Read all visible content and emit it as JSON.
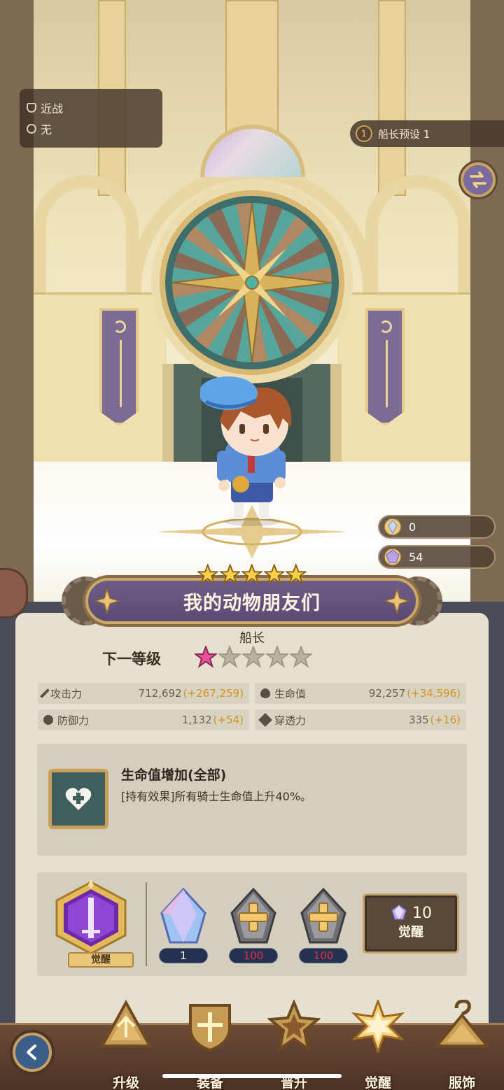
{
  "scene": {
    "attack_type": "近战",
    "element": "无",
    "preset": {
      "number": "1",
      "label": "船长预设 1"
    },
    "currencies": [
      {
        "icon": "crystal-icon",
        "value": "0"
      },
      {
        "icon": "purple-gem-icon",
        "value": "54"
      }
    ]
  },
  "hero": {
    "name": "我的动物朋友们",
    "star_count": 5,
    "role": "船长"
  },
  "panel": {
    "next_level_label": "下一等级",
    "next_level_stars": 5,
    "next_level_filled": 1,
    "stats": [
      {
        "icon": "sword-icon",
        "label": "攻击力",
        "value": "712,692",
        "bonus": "(+267,259)"
      },
      {
        "icon": "heart-icon",
        "label": "生命值",
        "value": "92,257",
        "bonus": "(+34,596)"
      },
      {
        "icon": "shield-icon",
        "label": "防御力",
        "value": "1,132",
        "bonus": "(+54)"
      },
      {
        "icon": "pierce-icon",
        "label": "穿透力",
        "value": "335",
        "bonus": "(+16)"
      }
    ],
    "effect": {
      "title": "生命值增加(全部)",
      "description": "[持有效果]所有骑士生命值上升40%。"
    },
    "awaken": {
      "badge_label": "觉醒",
      "materials": [
        {
          "icon": "crystal-shard-icon",
          "count": "1",
          "insufficient": false
        },
        {
          "icon": "plus-slot-icon",
          "count": "100",
          "insufficient": true
        },
        {
          "icon": "plus-slot-icon",
          "count": "100",
          "insufficient": true
        }
      ],
      "button": {
        "cost": "10",
        "label": "觉醒"
      }
    }
  },
  "nav": {
    "back_icon": "back-arrow-icon",
    "items": [
      {
        "label": "升级",
        "icon": "upgrade-icon"
      },
      {
        "label": "装备",
        "icon": "equip-icon"
      },
      {
        "label": "晋升",
        "icon": "promote-icon"
      },
      {
        "label": "觉醒",
        "icon": "awaken-icon",
        "active": true
      },
      {
        "label": "服饰",
        "icon": "costume-icon"
      }
    ]
  },
  "colors": {
    "accent_gold": "#c9a46a",
    "bonus_orange": "#d6921e",
    "insufficient_red": "#e0314a",
    "banner_purple": "#6f5d88"
  }
}
